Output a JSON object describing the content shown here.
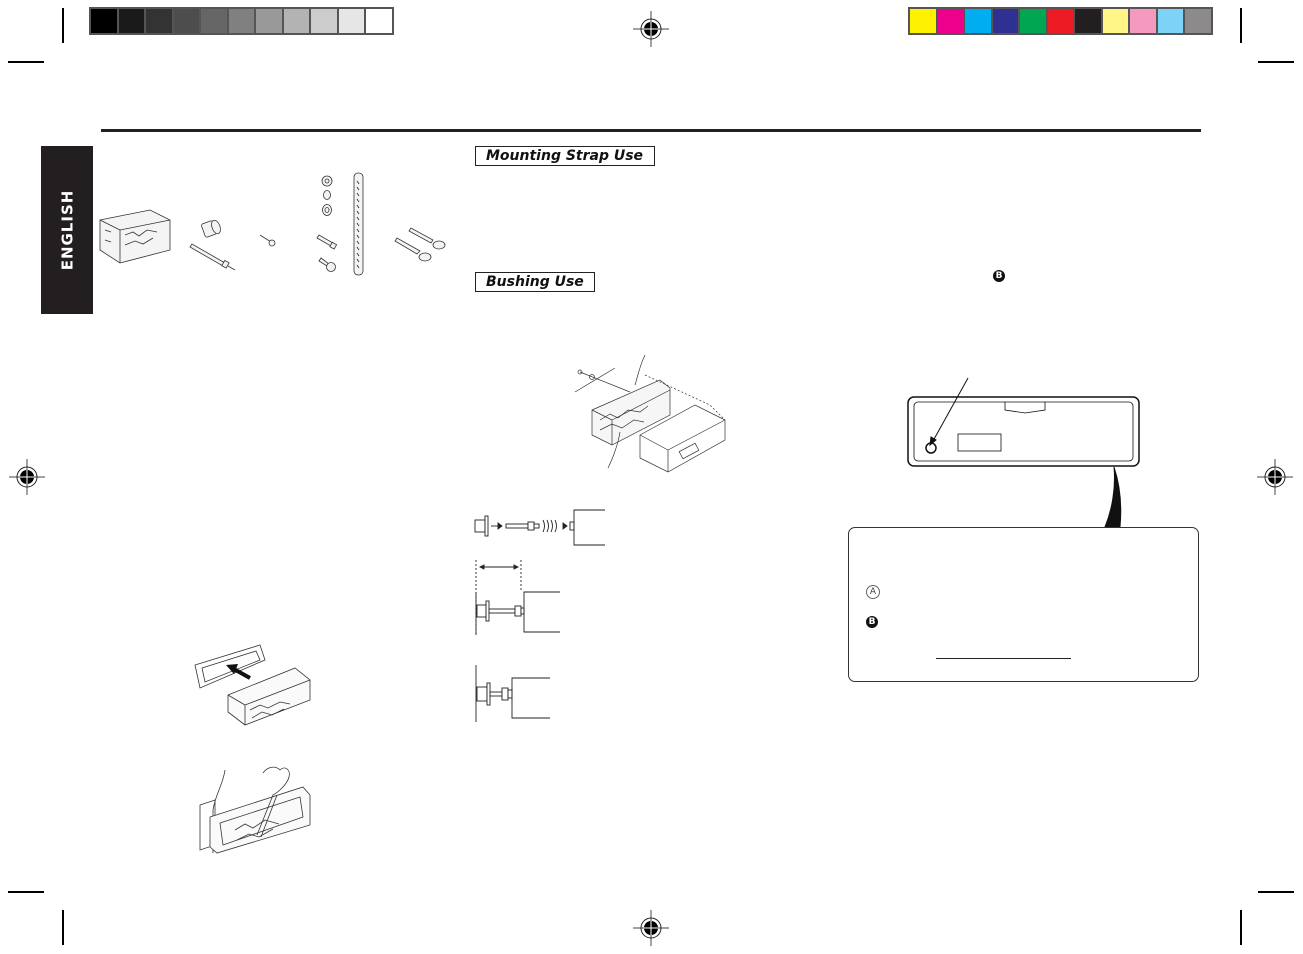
{
  "page": {
    "language_tab": "ENGLISH",
    "sections": [
      {
        "heading": "Mounting Strap Use"
      },
      {
        "heading": "Bushing Use"
      }
    ],
    "callout": {
      "markers": [
        "A",
        "B"
      ]
    },
    "inline_marker": "B"
  },
  "print_marks": {
    "grayscale_swatches": [
      "#000000",
      "#1a1a1a",
      "#333333",
      "#4d4d4d",
      "#666666",
      "#808080",
      "#999999",
      "#b3b3b3",
      "#cccccc",
      "#e6e6e6",
      "#ffffff"
    ],
    "color_swatches": [
      "#fff200",
      "#ec008c",
      "#00aeef",
      "#2e3192",
      "#00a651",
      "#ed1c24",
      "#231f20",
      "#fff685",
      "#f49ac1",
      "#7dd3f7",
      "#8c8a8b"
    ],
    "border_color": "#555555"
  },
  "figures": [
    {
      "name": "accessory-parts"
    },
    {
      "name": "mounting-strap-sleeve-diagram"
    },
    {
      "name": "bushing-assembly-steps"
    },
    {
      "name": "unit-insertion-diagram"
    },
    {
      "name": "unit-removal-diagram"
    },
    {
      "name": "faceplate-reset-diagram"
    }
  ]
}
